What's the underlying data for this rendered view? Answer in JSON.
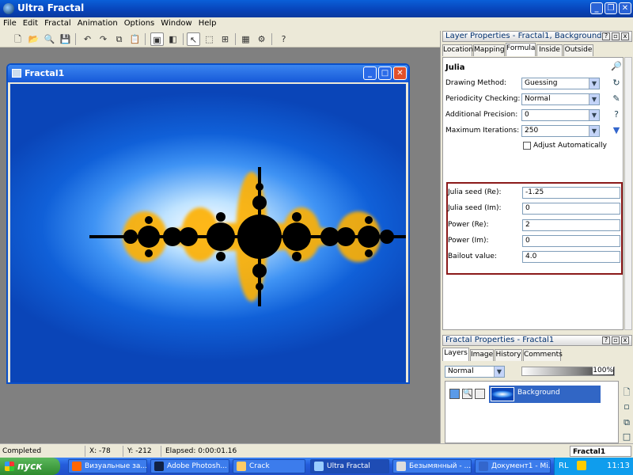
{
  "app": {
    "title": "Ultra Fractal"
  },
  "menu": [
    "File",
    "Edit",
    "Fractal",
    "Animation",
    "Options",
    "Window",
    "Help"
  ],
  "fractal_window": {
    "title": "Fractal1"
  },
  "layer_panel": {
    "title": "Layer Properties - Fractal1, Background",
    "tabs": [
      "Location",
      "Mapping",
      "Formula",
      "Inside",
      "Outside"
    ],
    "selected_tab": "Formula",
    "formula_name": "Julia",
    "drawing_method": {
      "label": "Drawing Method:",
      "value": "Guessing"
    },
    "periodicity": {
      "label": "Periodicity Checking:",
      "value": "Normal"
    },
    "precision": {
      "label": "Additional Precision:",
      "value": "0"
    },
    "max_iter": {
      "label": "Maximum Iterations:",
      "value": "250"
    },
    "adjust": {
      "label": "Adjust Automatically",
      "checked": false
    },
    "params": [
      {
        "label": "Julia seed (Re):",
        "value": "-1.25"
      },
      {
        "label": "Julia seed (Im):",
        "value": "0"
      },
      {
        "label": "Power (Re):",
        "value": "2"
      },
      {
        "label": "Power (Im):",
        "value": "0"
      },
      {
        "label": "Bailout value:",
        "value": "4.0"
      }
    ]
  },
  "fractal_panel": {
    "title": "Fractal Properties - Fractal1",
    "tabs": [
      "Layers",
      "Image",
      "History",
      "Comments"
    ],
    "selected_tab": "Layers",
    "mode": "Normal",
    "opacity": "100%",
    "layer_name": "Background"
  },
  "status": {
    "state": "Completed",
    "x": "X: -78",
    "y": "Y: -212",
    "elapsed": "Elapsed: 0:00:01.16",
    "doc": "Fractal1"
  },
  "taskbar": {
    "start": "пуск",
    "tasks": [
      "Визуальные за...",
      "Adobe Photosh...",
      "Crack",
      "Ultra Fractal",
      "Безымянный - ...",
      "Документ1 - Mi..."
    ],
    "active_task": "Ultra Fractal",
    "lang": "RL",
    "clock": "11:13"
  }
}
